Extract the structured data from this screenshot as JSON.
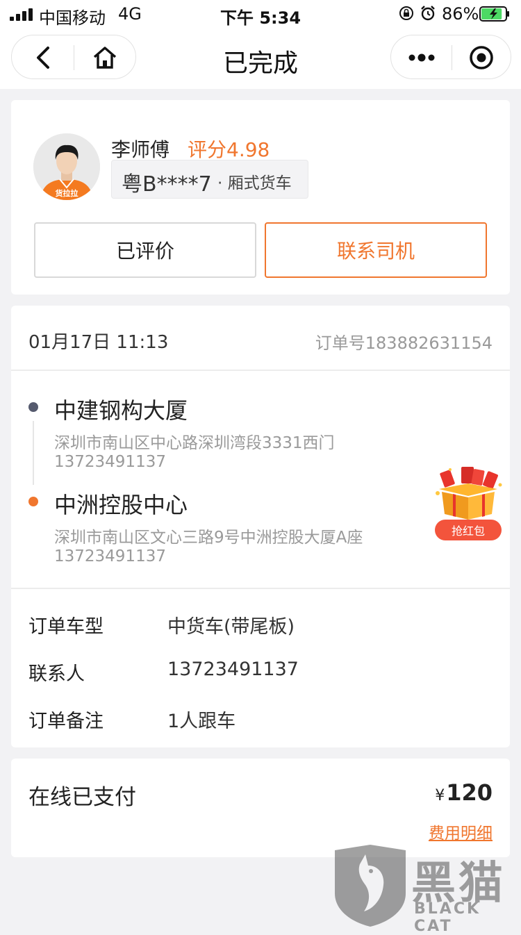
{
  "status_bar": {
    "carrier": "中国移动",
    "network": "4G",
    "time": "下午 5:34",
    "battery_percent": "86%",
    "battery_level": 0.86,
    "battery_color": "#4cd964"
  },
  "nav": {
    "title": "已完成",
    "back_icon": "chevron-left-icon",
    "home_icon": "home-icon",
    "more_icon": "more-dots-icon",
    "close_icon": "target-circle-icon"
  },
  "driver": {
    "name": "李师傅",
    "rating": "评分4.98",
    "plate": "粤B****7",
    "car_type": "· 厢式货车",
    "avatar_badge": "货拉拉",
    "rated_button": "已评价",
    "contact_button": "联系司机"
  },
  "order": {
    "date": "01月17日 11:13",
    "order_no": "订单号183882631154",
    "start": {
      "name": "中建钢构大厦",
      "address": "深圳市南山区中心路深圳湾段3331西门",
      "phone": "13723491137"
    },
    "end": {
      "name": "中洲控股中心",
      "address": "深圳市南山区文心三路9号中洲控股大厦A座",
      "phone": "13723491137"
    },
    "red_packet_label": "抢红包",
    "details": [
      {
        "label": "订单车型",
        "value": "中货车(带尾板)"
      },
      {
        "label": "联系人",
        "value": "13723491137"
      },
      {
        "label": "订单备注",
        "value": "1人跟车"
      }
    ]
  },
  "payment": {
    "label": "在线已支付",
    "currency": "¥",
    "amount": "120",
    "fee_detail_link": "费用明细"
  },
  "watermark": {
    "cn": "黑猫",
    "en": "BLACK CAT"
  },
  "colors": {
    "accent": "#f0762e",
    "start_dot": "#555a6e",
    "red_packet": "#f3543c"
  }
}
